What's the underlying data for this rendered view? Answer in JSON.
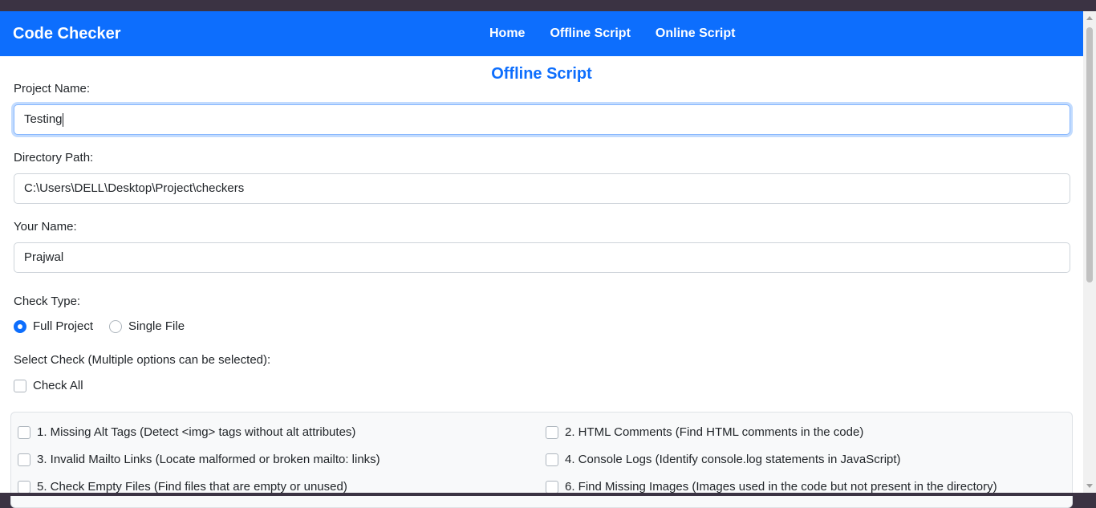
{
  "navbar": {
    "brand": "Code Checker",
    "links": [
      "Home",
      "Offline Script",
      "Online Script"
    ]
  },
  "page_title": "Offline Script",
  "form": {
    "project_name_label": "Project Name:",
    "project_name_value": "Testing",
    "directory_label": "Directory Path:",
    "directory_value": "C:\\Users\\DELL\\Desktop\\Project\\checkers",
    "your_name_label": "Your Name:",
    "your_name_value": "Prajwal",
    "check_type_label": "Check Type:",
    "check_type_options": [
      {
        "label": "Full Project",
        "checked": true
      },
      {
        "label": "Single File",
        "checked": false
      }
    ],
    "select_check_label": "Select Check (Multiple options can be selected):",
    "check_all_label": "Check All",
    "checks": [
      "1. Missing Alt Tags (Detect <img> tags without alt attributes)",
      "2. HTML Comments (Find HTML comments in the code)",
      "3. Invalid Mailto Links (Locate malformed or broken mailto: links)",
      "4. Console Logs (Identify console.log statements in JavaScript)",
      "5. Check Empty Files (Find files that are empty or unused)",
      "6. Find Missing Images (Images used in the code but not present in the directory)"
    ]
  },
  "colors": {
    "primary": "#0d6efd",
    "window_frame": "#3b3343"
  }
}
